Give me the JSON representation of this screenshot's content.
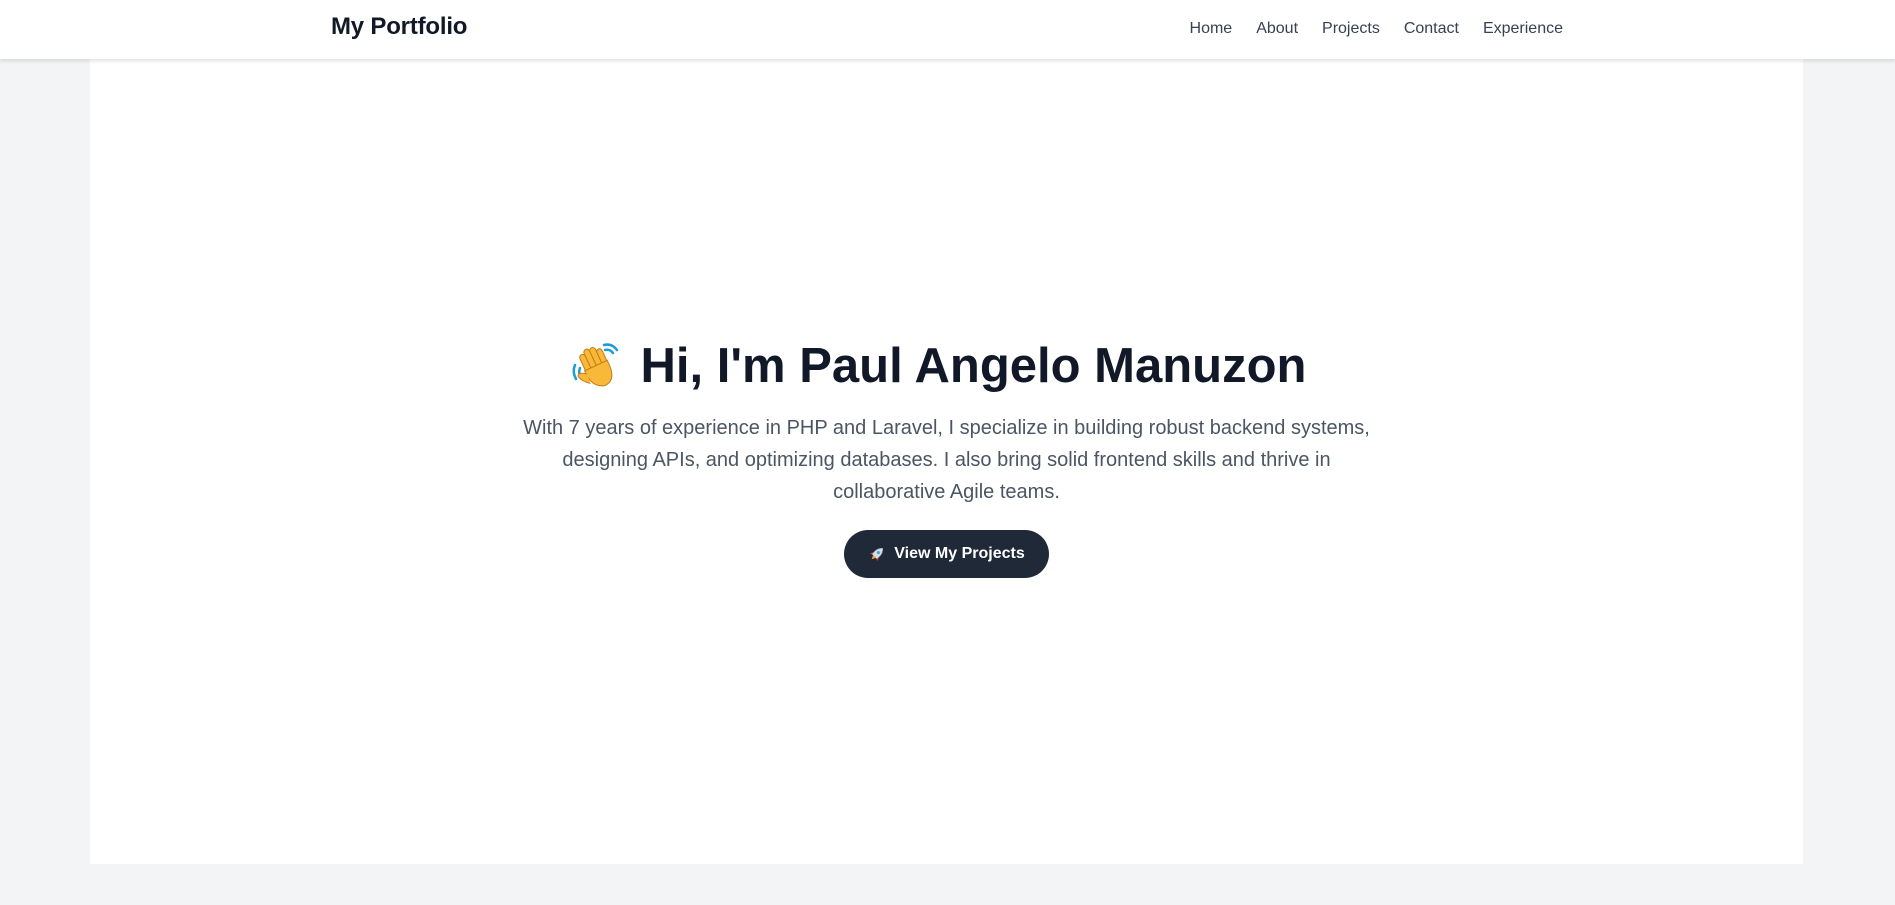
{
  "nav": {
    "brand": "My Portfolio",
    "links": [
      "Home",
      "About",
      "Projects",
      "Contact",
      "Experience"
    ]
  },
  "hero": {
    "title_icon": "waving-hand-icon",
    "title": "Hi, I'm Paul Angelo Manuzon",
    "description": "With 7 years of experience in PHP and Laravel, I specialize in building robust backend systems, designing APIs, and optimizing databases. I also bring solid frontend skills and thrive in collaborative Agile teams.",
    "cta_icon": "rocket-icon",
    "cta_label": "View My Projects"
  },
  "colors": {
    "page_background": "#f3f4f6",
    "surface": "#ffffff",
    "text_primary": "#111827",
    "text_secondary": "#4b5563",
    "nav_text": "#374151",
    "button_background": "#1f2937",
    "button_text": "#ffffff"
  }
}
